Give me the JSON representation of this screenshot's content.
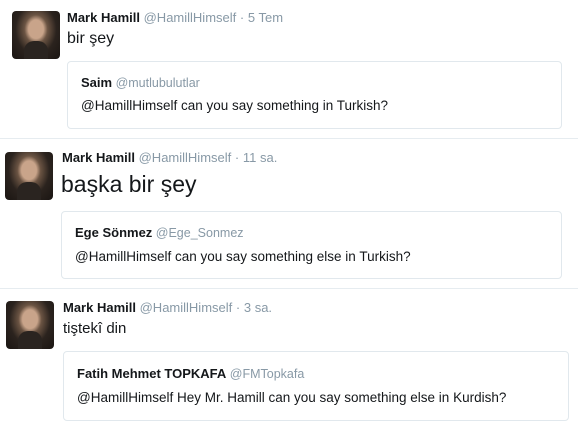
{
  "tweets": [
    {
      "name": "Mark Hamill",
      "handle": "@HamillHimself",
      "separator": "·",
      "time": "5 Tem",
      "text": "bir şey",
      "quote": {
        "name": "Saim",
        "handle": "@mutlubulutlar",
        "text": "@HamillHimself can you say something in Turkish?"
      }
    },
    {
      "name": "Mark Hamill",
      "handle": "@HamillHimself",
      "separator": "·",
      "time": "11 sa.",
      "text": "başka bir şey",
      "quote": {
        "name": "Ege Sönmez",
        "handle": "@Ege_Sonmez",
        "text": "@HamillHimself can you say something else in Turkish?"
      }
    },
    {
      "name": "Mark Hamill",
      "handle": "@HamillHimself",
      "separator": "·",
      "time": "3 sa.",
      "text": "tiştekî din",
      "quote": {
        "name": "Fatih Mehmet TOPKAFA",
        "handle": "@FMTopkafa",
        "text": "@HamillHimself Hey Mr. Hamill can you say something else in Kurdish?"
      }
    }
  ],
  "colors": {
    "text": "#14171a",
    "muted": "#8899a6",
    "border": "#e1e8ed"
  }
}
